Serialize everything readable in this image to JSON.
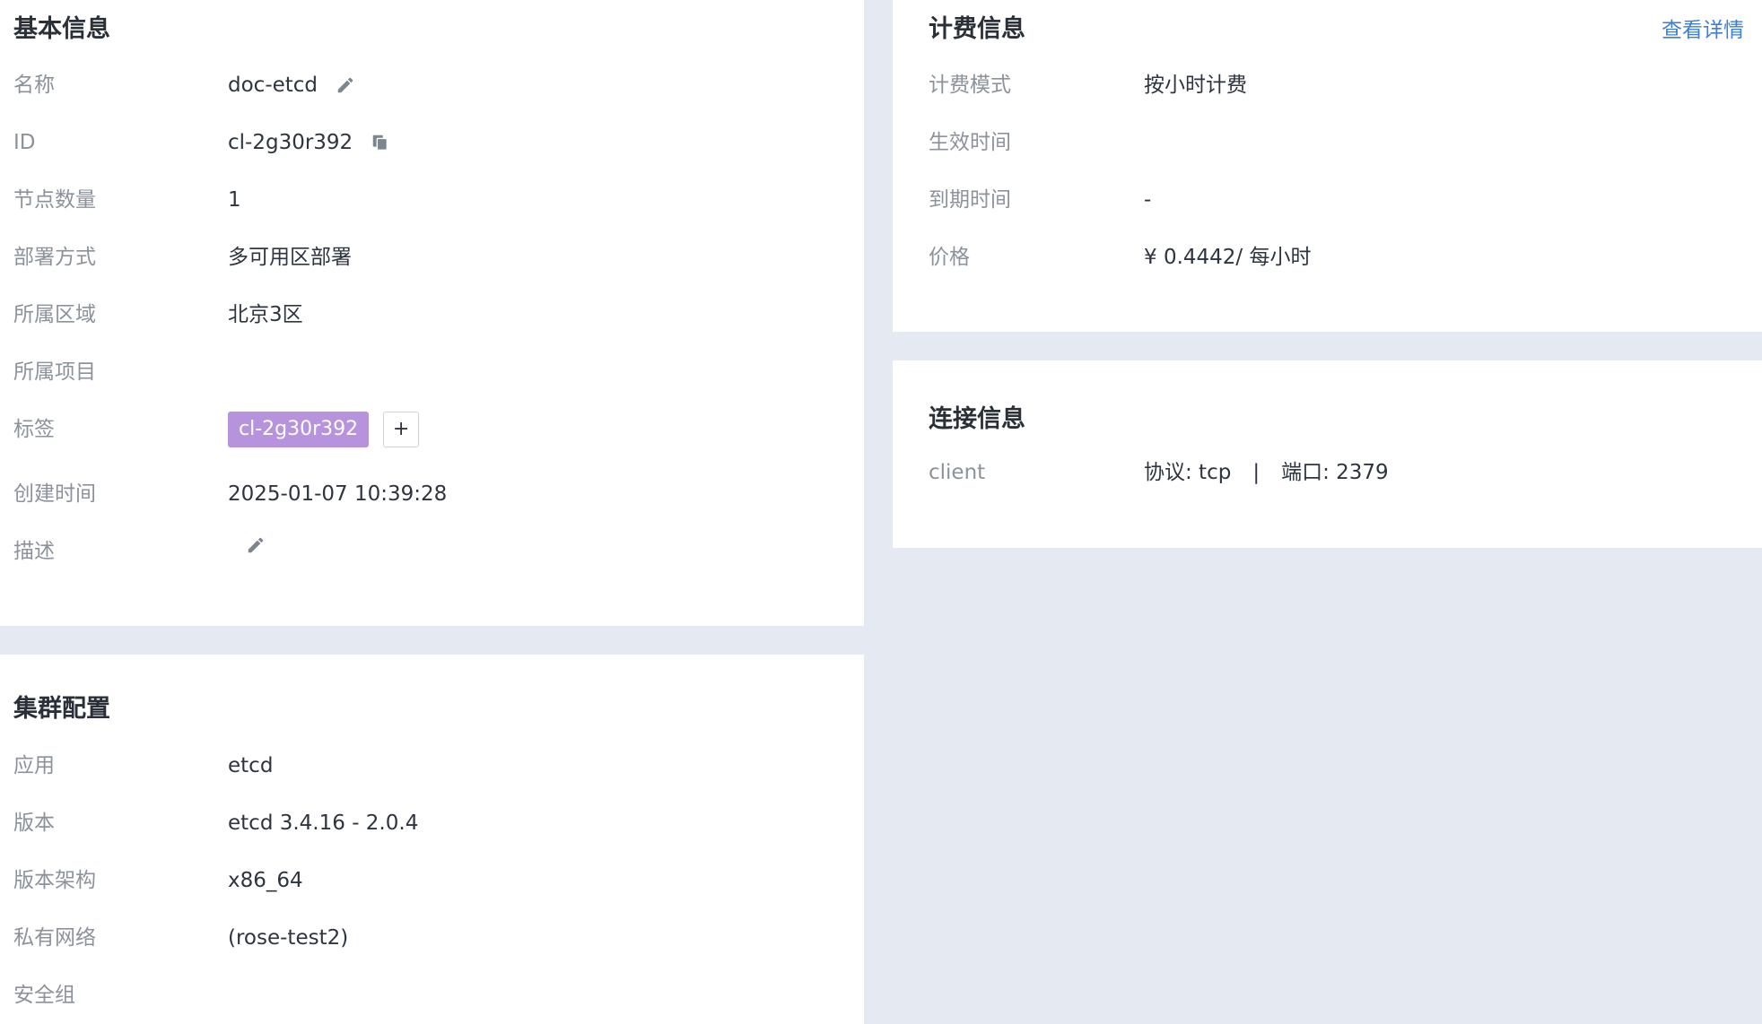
{
  "basic": {
    "title": "基本信息",
    "rows": [
      {
        "label": "名称",
        "value": "doc-etcd"
      },
      {
        "label": "ID",
        "value": "cl-2g30r392"
      },
      {
        "label": "节点数量",
        "value": "1"
      },
      {
        "label": "部署方式",
        "value": "多可用区部署"
      },
      {
        "label": "所属区域",
        "value": "北京3区"
      },
      {
        "label": "所属项目",
        "value": ""
      },
      {
        "label": "标签",
        "tag": "cl-2g30r392",
        "add_label": "+"
      },
      {
        "label": "创建时间",
        "value": "2025-01-07 10:39:28"
      },
      {
        "label": "描述",
        "value": ""
      }
    ]
  },
  "cluster": {
    "title": "集群配置",
    "rows": [
      {
        "label": "应用",
        "value": "etcd"
      },
      {
        "label": "版本",
        "value": "etcd 3.4.16 - 2.0.4"
      },
      {
        "label": "版本架构",
        "value": "x86_64"
      },
      {
        "label": "私有网络",
        "value": "(rose-test2)"
      },
      {
        "label": "安全组",
        "value": ""
      }
    ]
  },
  "billing": {
    "title": "计费信息",
    "detail_link": "查看详情",
    "rows": [
      {
        "label": "计费模式",
        "value": "按小时计费"
      },
      {
        "label": "生效时间",
        "value": ""
      },
      {
        "label": "到期时间",
        "value": "-"
      },
      {
        "label": "价格",
        "value": "¥ 0.4442/ 每小时"
      }
    ]
  },
  "connection": {
    "title": "连接信息",
    "rows": [
      {
        "label": "client",
        "protocol": "协议: tcp",
        "separator": "|",
        "port": "端口: 2379"
      }
    ]
  },
  "icons": {
    "edit": "pencil-icon",
    "copy": "copy-icon"
  },
  "colors": {
    "background": "#e5e9f1",
    "panel": "#ffffff",
    "link": "#3b7fd8",
    "tag": "#b793de",
    "label": "#8c929c",
    "value": "#2e3440"
  }
}
